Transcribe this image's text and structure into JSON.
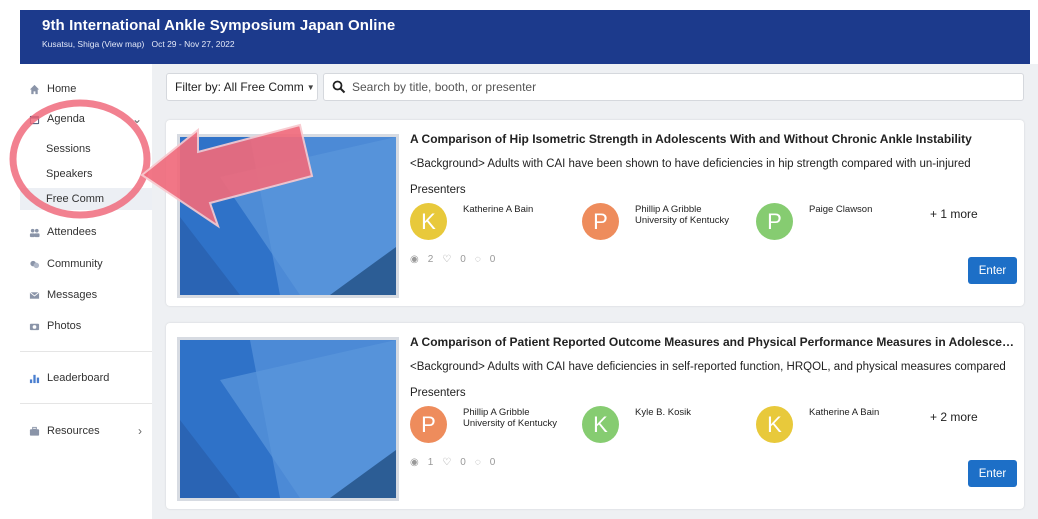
{
  "header": {
    "title": "9th International Ankle Symposium Japan Online",
    "location": "Kusatsu, Shiga",
    "map_link": "(View map)",
    "dates": "Oct 29 - Nov 27, 2022",
    "bg_color": "#1c3a8c"
  },
  "sidebar": {
    "items": [
      {
        "label": "Home",
        "icon": "home-icon"
      },
      {
        "label": "Agenda",
        "icon": "calendar-icon"
      },
      {
        "label": "Sessions"
      },
      {
        "label": "Speakers"
      },
      {
        "label": "Free Comm"
      },
      {
        "label": "Attendees",
        "icon": "people-icon"
      },
      {
        "label": "Community",
        "icon": "chat-icon"
      },
      {
        "label": "Messages",
        "icon": "mail-icon"
      },
      {
        "label": "Photos",
        "icon": "camera-icon"
      },
      {
        "label": "Leaderboard",
        "icon": "bar-chart-icon"
      },
      {
        "label": "Resources",
        "icon": "briefcase-icon"
      }
    ]
  },
  "toolbar": {
    "filter_label": "Filter by: All Free Comm",
    "search_placeholder": "Search by title, booth, or presenter"
  },
  "cards": [
    {
      "title": "A Comparison of Hip Isometric Strength in Adolescents With and Without Chronic Ankle Instability",
      "description": "<Background> Adults with CAI have been shown to have deficiencies in hip strength compared with un-injured",
      "presenters_label": "Presenters",
      "presenters": [
        {
          "initial": "K",
          "name": "Katherine A Bain",
          "affiliation": "",
          "color": "#e8c93b"
        },
        {
          "initial": "P",
          "name": "Phillip A Gribble",
          "affiliation": "University of Kentucky",
          "color": "#ee8c5c"
        },
        {
          "initial": "P",
          "name": "Paige Clawson",
          "affiliation": "",
          "color": "#86cc71"
        }
      ],
      "more": "+ 1 more",
      "views": "2",
      "likes": "0",
      "comments": "0",
      "enter_label": "Enter"
    },
    {
      "title": "A Comparison of Patient Reported Outcome Measures and Physical Performance Measures in Adolescents",
      "description": "<Background> Adults with CAI have deficiencies in self-reported function, HRQOL, and physical measures compared",
      "presenters_label": "Presenters",
      "presenters": [
        {
          "initial": "P",
          "name": "Phillip A Gribble",
          "affiliation": "University of Kentucky",
          "color": "#ee8c5c"
        },
        {
          "initial": "K",
          "name": "Kyle B. Kosik",
          "affiliation": "",
          "color": "#86cc71"
        },
        {
          "initial": "K",
          "name": "Katherine A Bain",
          "affiliation": "",
          "color": "#e8c93b"
        }
      ],
      "more": "+ 2 more",
      "views": "1",
      "likes": "0",
      "comments": "0",
      "enter_label": "Enter"
    }
  ],
  "annotation": {
    "highlight_color": "#f06b7c"
  }
}
